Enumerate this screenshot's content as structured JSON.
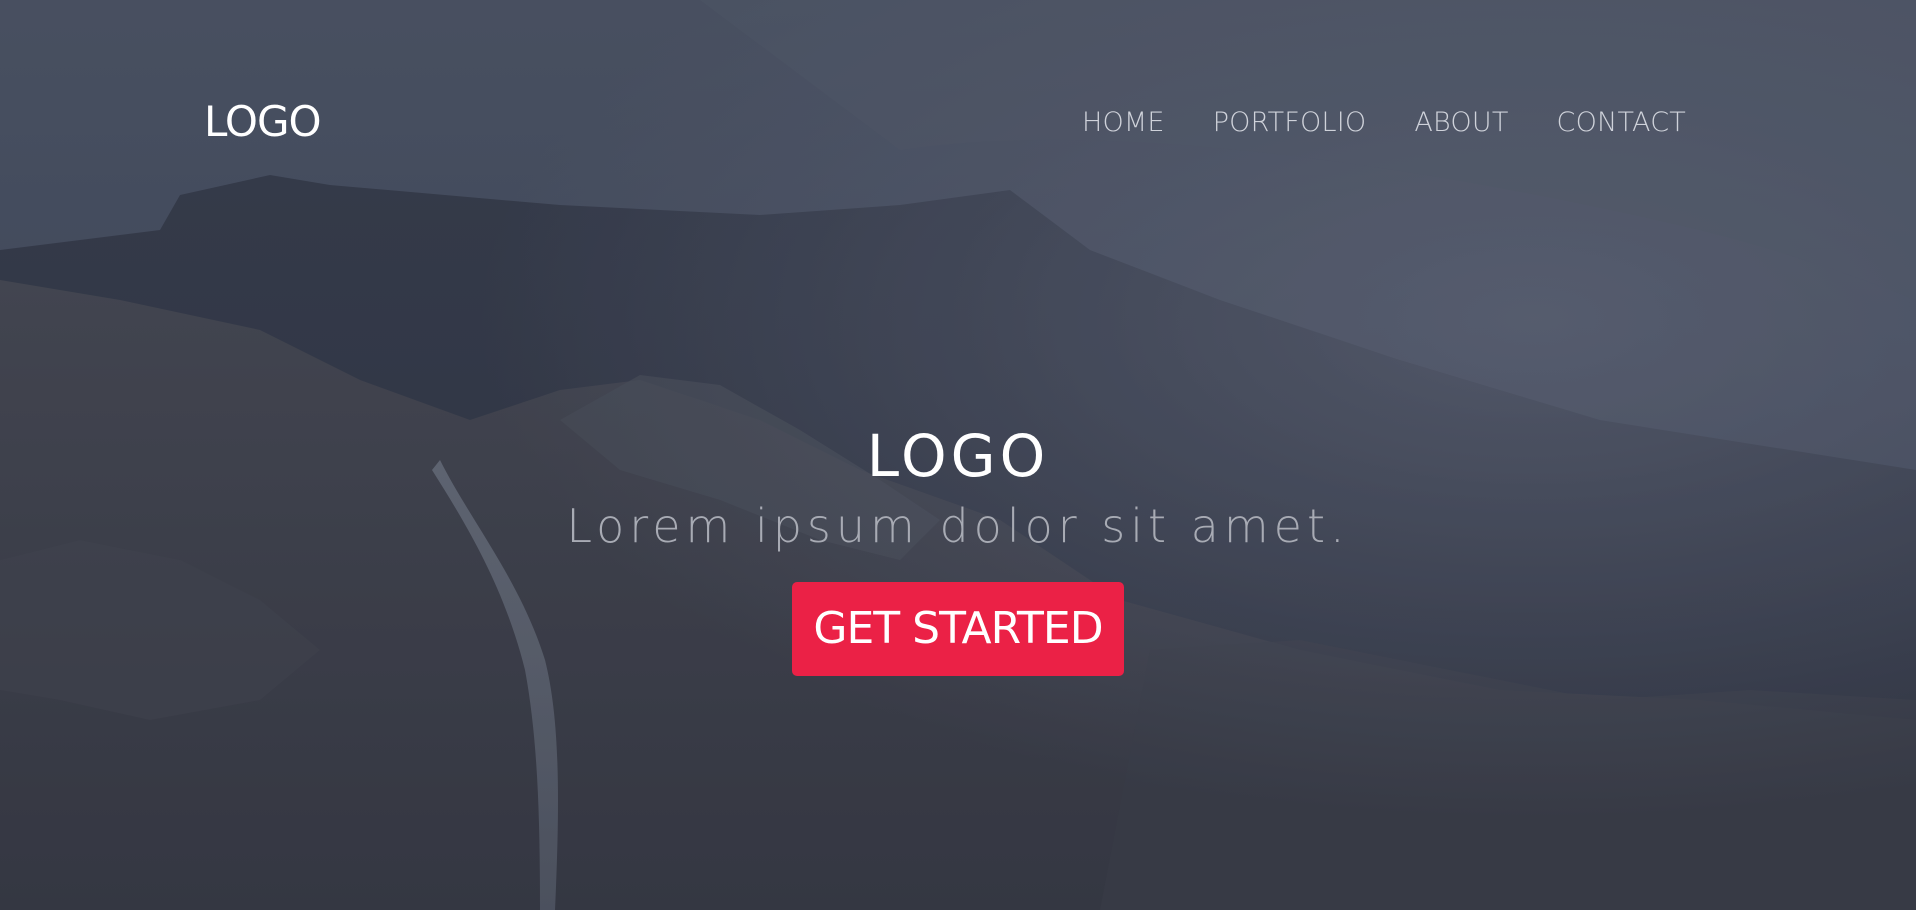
{
  "navbar": {
    "logo": "LOGO",
    "links": [
      "HOME",
      "PORTFOLIO",
      "ABOUT",
      "CONTACT"
    ]
  },
  "hero": {
    "title": "LOGO",
    "subtitle": "Lorem ipsum dolor sit amet.",
    "cta_label": "GET STARTED"
  },
  "colors": {
    "accent": "#eb2146",
    "nav_text": "#cfd2da",
    "subtitle_text": "#a8abb4",
    "sky": "#4a5263"
  }
}
